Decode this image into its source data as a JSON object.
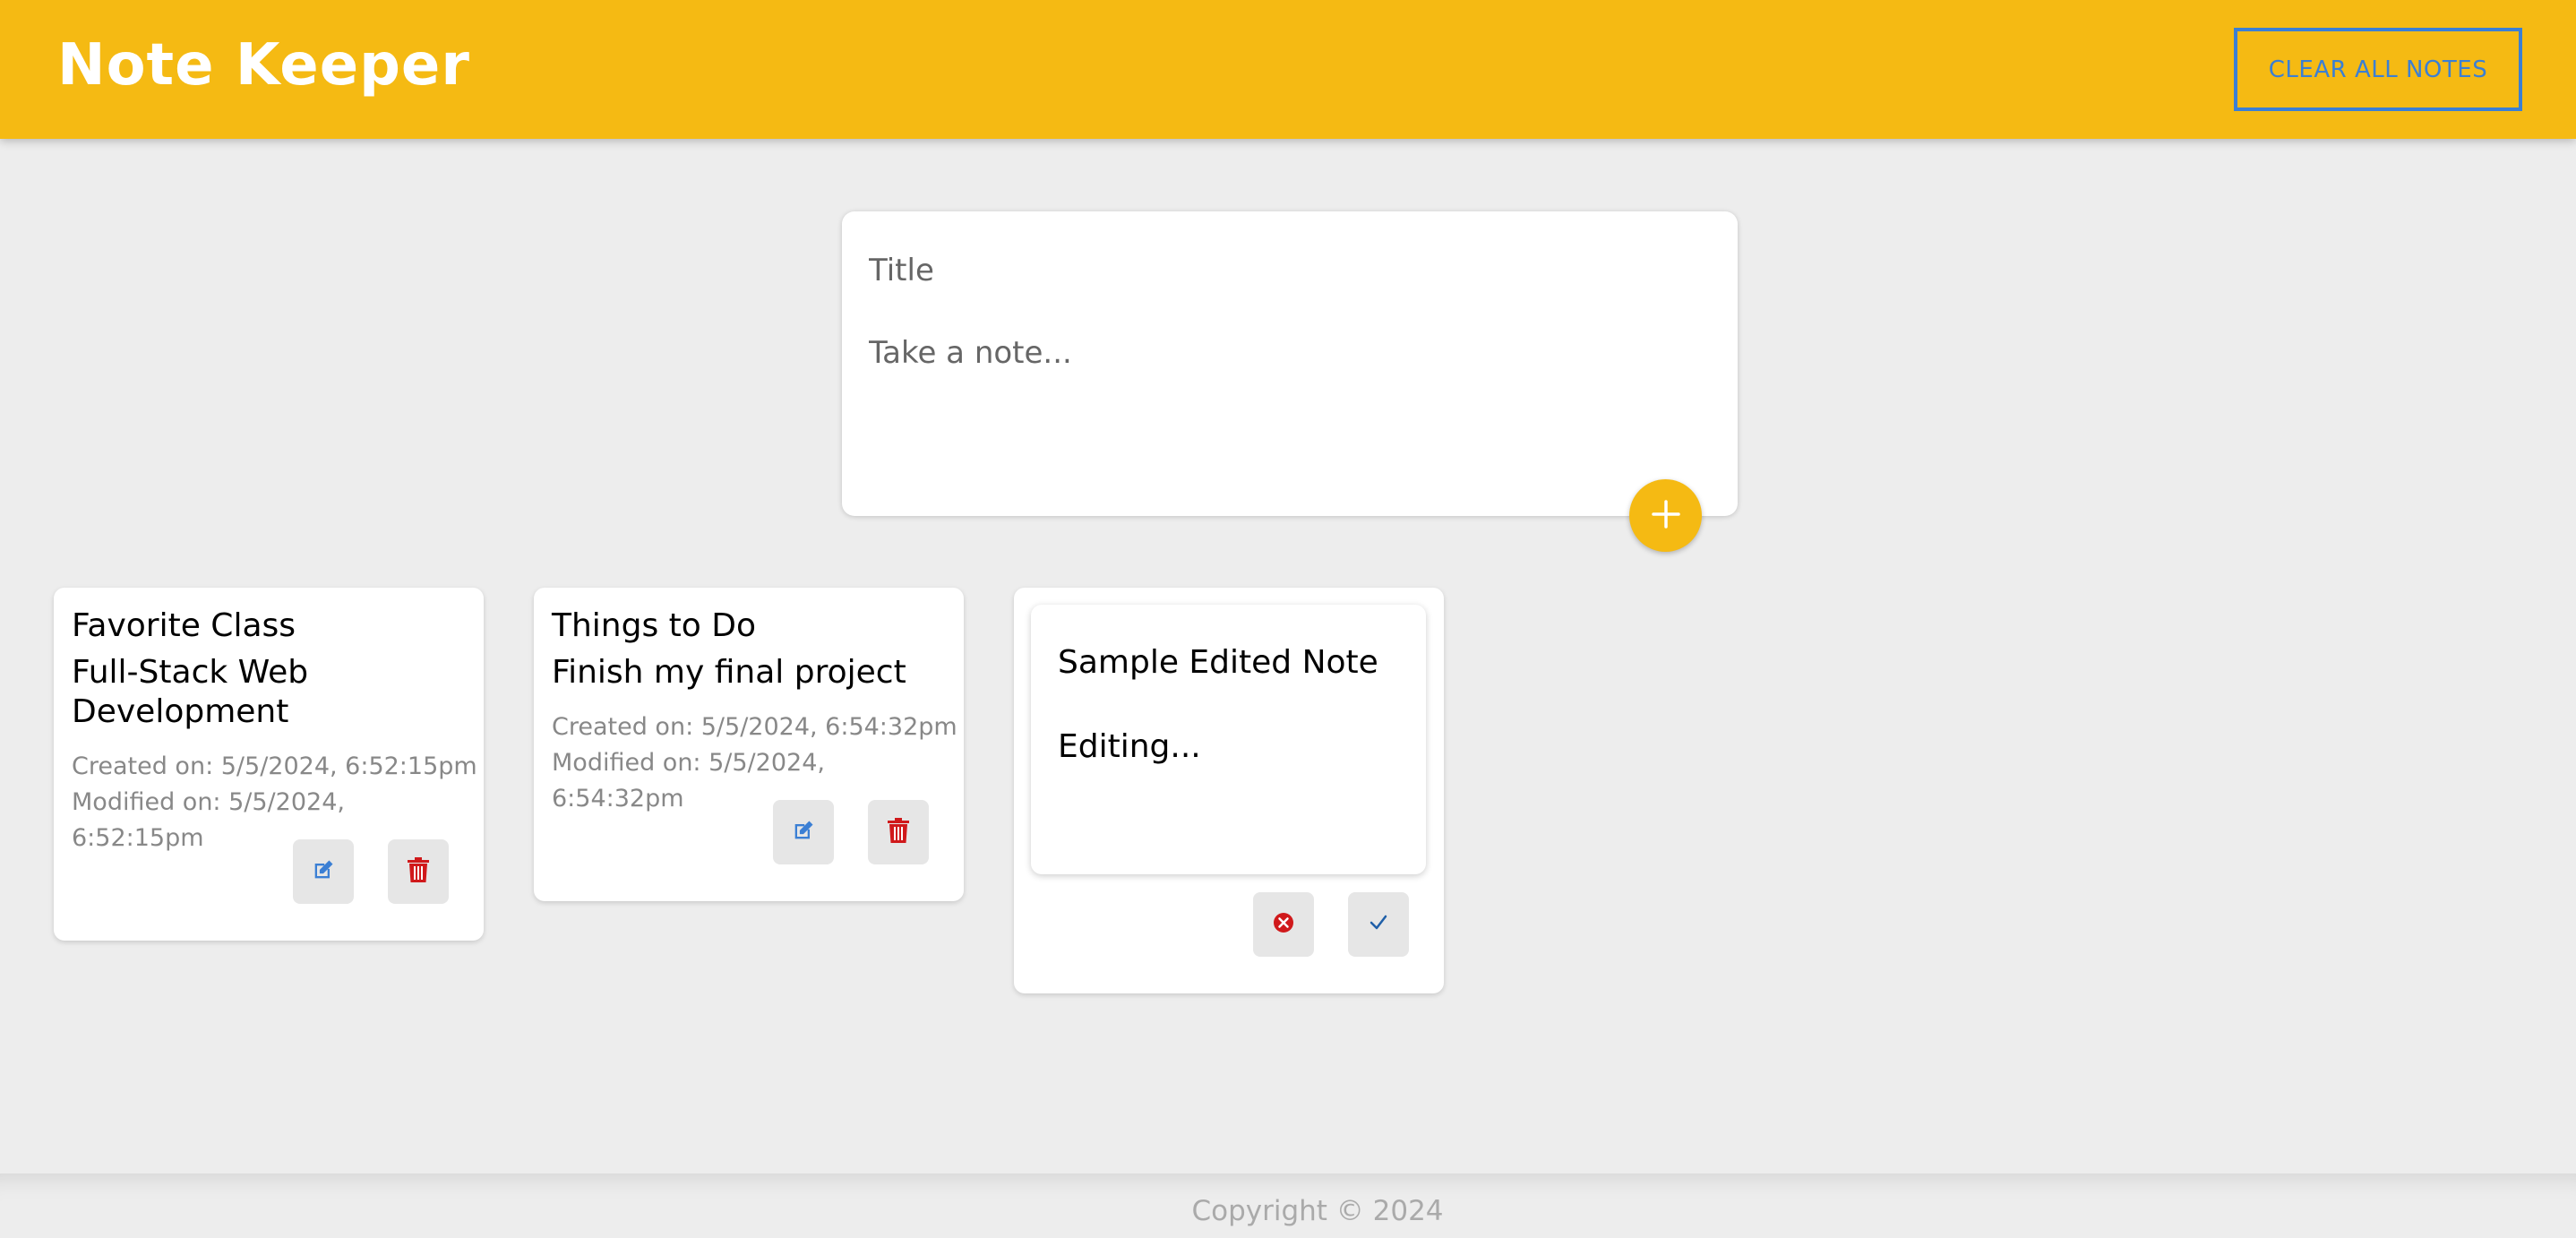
{
  "header": {
    "app_title": "Note Keeper",
    "clear_label": "CLEAR ALL NOTES"
  },
  "composer": {
    "title_placeholder": "Title",
    "body_placeholder": "Take a note...",
    "add_icon": "plus-icon"
  },
  "notes": [
    {
      "title": "Favorite Class",
      "content": "Full-Stack Web Development",
      "created": "Created on: 5/5/2024, 6:52:15pm",
      "modified": "Modified on: 5/5/2024, 6:52:15pm",
      "edit_icon": "edit-icon",
      "delete_icon": "trash-icon"
    },
    {
      "title": "Things to Do",
      "content": "Finish my final project",
      "created": "Created on: 5/5/2024, 6:54:32pm",
      "modified": "Modified on: 5/5/2024, 6:54:32pm",
      "edit_icon": "edit-icon",
      "delete_icon": "trash-icon"
    }
  ],
  "editing_note": {
    "title_value": "Sample Edited Note",
    "body_value": "Editing...",
    "cancel_icon": "cancel-icon",
    "confirm_icon": "check-icon"
  },
  "footer": {
    "copyright": "Copyright © 2024"
  },
  "colors": {
    "header_bg": "#f5ba13",
    "accent_blue": "#3b7fd4",
    "delete_red": "#d0191b",
    "page_bg": "#ededed"
  }
}
